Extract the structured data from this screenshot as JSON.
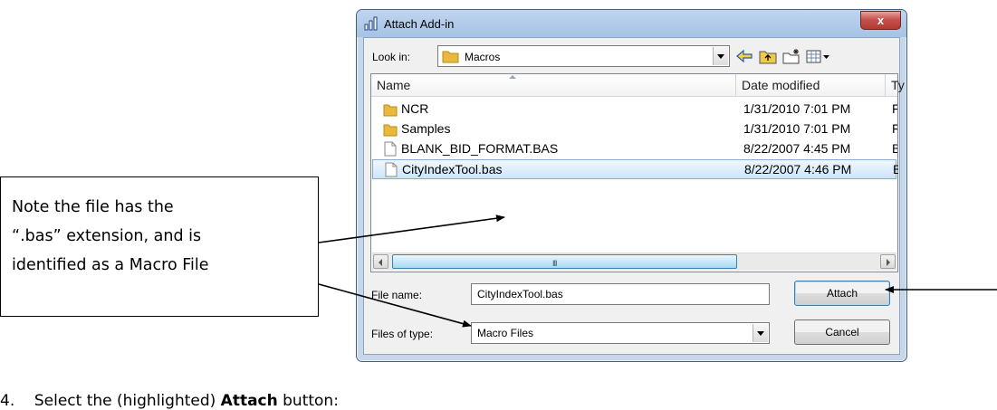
{
  "dialog": {
    "title": "Attach Add-in",
    "close_label": "x",
    "look_in_label": "Look in:",
    "look_in_value": "Macros",
    "columns": {
      "name": "Name",
      "date": "Date modified",
      "type": "Ty"
    },
    "files": [
      {
        "name": "NCR",
        "date": "1/31/2010 7:01 PM",
        "type": "Fi",
        "icon": "folder-icon"
      },
      {
        "name": "Samples",
        "date": "1/31/2010 7:01 PM",
        "type": "Fi",
        "icon": "folder-icon"
      },
      {
        "name": "BLANK_BID_FORMAT.BAS",
        "date": "8/22/2007 4:45 PM",
        "type": "B/",
        "icon": "file-icon"
      },
      {
        "name": "CityIndexTool.bas",
        "date": "8/22/2007 4:46 PM",
        "type": "B/",
        "icon": "file-icon",
        "selected": true
      }
    ],
    "scroll_grip": "III",
    "file_name_label": "File name:",
    "file_name_value": "CityIndexTool.bas",
    "files_of_type_label": "Files of type:",
    "files_of_type_value": "Macro Files",
    "attach_label": "Attach",
    "cancel_label": "Cancel"
  },
  "callout": {
    "line1": "Note the file has the",
    "line2": "“.bas” extension, and is",
    "line3": "identified as a Macro File"
  },
  "footer": {
    "number": "4.",
    "text_before": "Select the (highlighted) ",
    "bold": "Attach",
    "text_after": " button:"
  }
}
